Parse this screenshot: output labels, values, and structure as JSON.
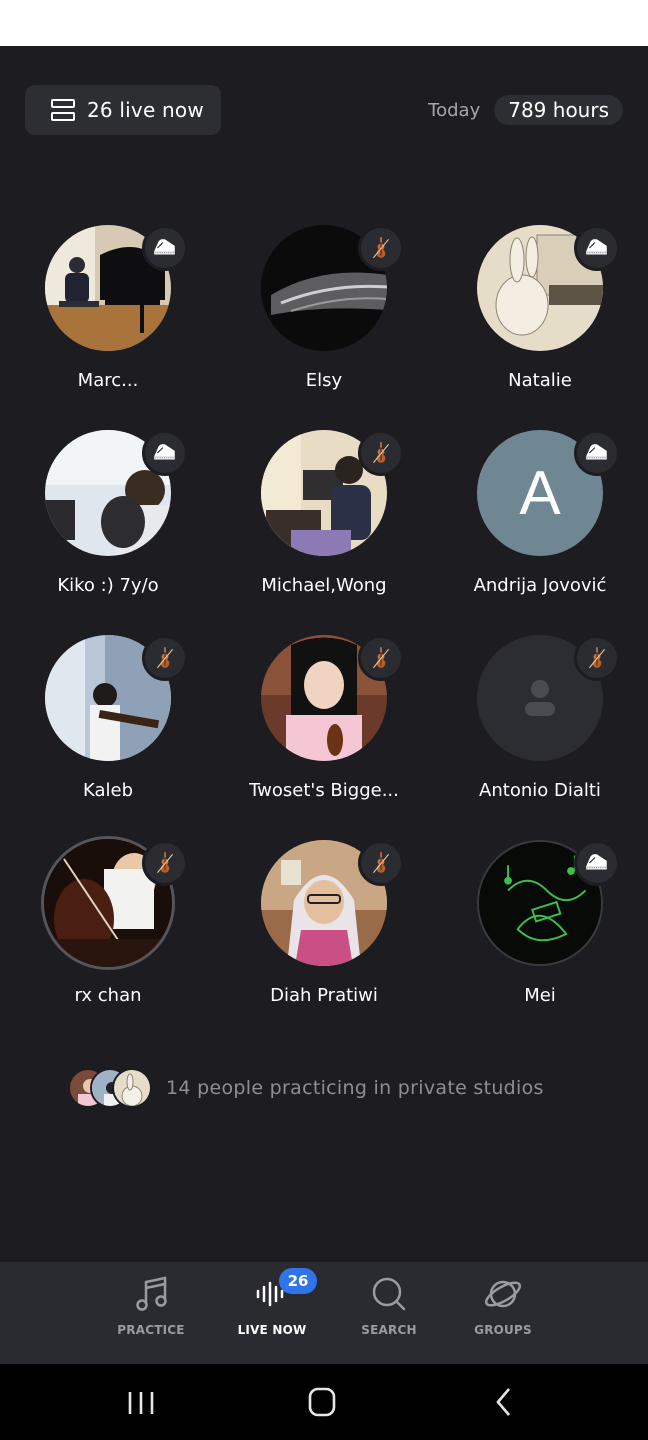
{
  "header": {
    "live_label": "26 live now",
    "today_label": "Today",
    "hours_label": "789 hours"
  },
  "users": [
    {
      "name": "Marc...",
      "instrument": "piano-icon"
    },
    {
      "name": "Elsy",
      "instrument": "violin-icon"
    },
    {
      "name": "Natalie",
      "instrument": "piano-icon"
    },
    {
      "name": "Kiko :) 7y/o",
      "instrument": "piano-icon"
    },
    {
      "name": "Michael,Wong",
      "instrument": "violin-icon"
    },
    {
      "name": "Andrija Jovović",
      "instrument": "piano-icon",
      "initial": "A"
    },
    {
      "name": "Kaleb",
      "instrument": "violin-icon"
    },
    {
      "name": "Twoset's Bigge...",
      "instrument": "violin-icon"
    },
    {
      "name": "Antonio Dialti",
      "instrument": "violin-icon"
    },
    {
      "name": "rx chan",
      "instrument": "violin-icon"
    },
    {
      "name": "Diah Pratiwi",
      "instrument": "violin-icon"
    },
    {
      "name": "Mei",
      "instrument": "piano-icon"
    }
  ],
  "private_studios": {
    "text": "14 people practicing in private studios"
  },
  "tabs": [
    {
      "label": "PRACTICE",
      "icon": "music-note-icon"
    },
    {
      "label": "LIVE NOW",
      "icon": "sound-wave-icon",
      "badge": "26"
    },
    {
      "label": "SEARCH",
      "icon": "search-icon"
    },
    {
      "label": "GROUPS",
      "icon": "planet-icon"
    }
  ],
  "colors": {
    "background": "#1c1c21",
    "panel": "#2d2e34",
    "accent": "#2f74e8",
    "initial_avatar": "#6f8793"
  }
}
